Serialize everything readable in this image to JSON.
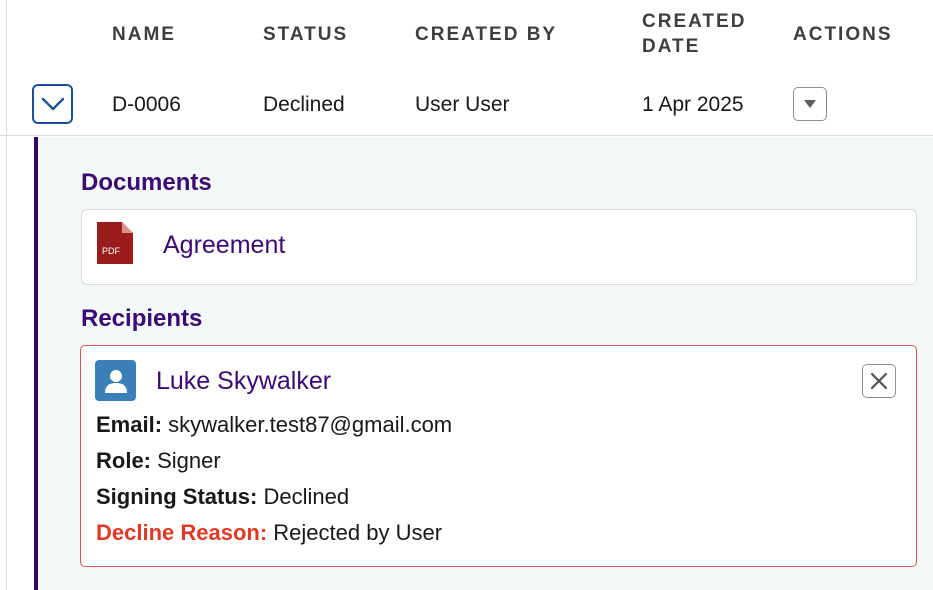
{
  "table": {
    "headers": {
      "name": "NAME",
      "status": "STATUS",
      "created_by": "CREATED BY",
      "created_date": "CREATED DATE",
      "actions": "ACTIONS"
    },
    "row": {
      "name": "D-0006",
      "status": "Declined",
      "created_by": "User User",
      "created_date": "1 Apr 2025"
    }
  },
  "details": {
    "documents_title": "Documents",
    "document": {
      "icon": "pdf-file-icon",
      "icon_label": "PDF",
      "name": "Agreement"
    },
    "recipients_title": "Recipients",
    "recipient": {
      "name": "Luke Skywalker",
      "email_label": "Email:",
      "email": "skywalker.test87@gmail.com",
      "role_label": "Role:",
      "role": "Signer",
      "signing_status_label": "Signing Status:",
      "signing_status": "Declined",
      "decline_reason_label": "Decline Reason:",
      "decline_reason": "Rejected by User"
    }
  },
  "colors": {
    "accent_purple": "#3b0a72",
    "toggle_blue": "#1b5297",
    "avatar_blue": "#3a7fb7",
    "decline_red": "#e03a24",
    "pdf_red": "#9b1c1c",
    "panel_bg": "#f3f8f8"
  }
}
